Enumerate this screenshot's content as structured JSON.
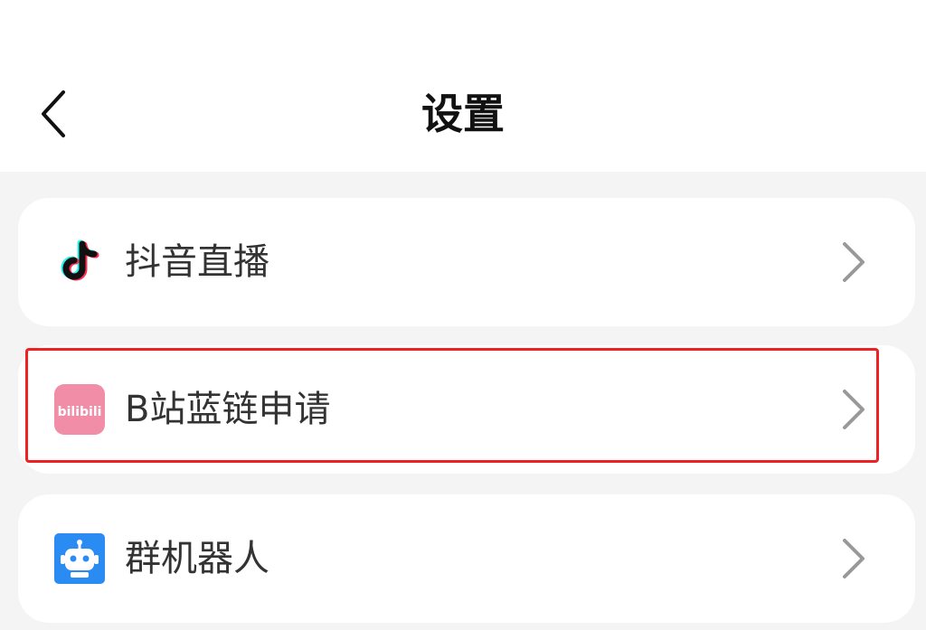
{
  "header": {
    "title": "设置",
    "back_icon": "chevron-left-icon"
  },
  "items": [
    {
      "label": "抖音直播",
      "icon": "douyin-icon",
      "chevron_icon": "chevron-right-icon"
    },
    {
      "label": "B站蓝链申请",
      "icon": "bilibili-icon",
      "icon_text": "bilibili",
      "chevron_icon": "chevron-right-icon",
      "highlighted": true
    },
    {
      "label": "群机器人",
      "icon": "robot-icon",
      "chevron_icon": "chevron-right-icon"
    }
  ],
  "colors": {
    "background": "#f4f4f4",
    "card": "#ffffff",
    "title": "#111111",
    "label": "#333333",
    "chevron": "#999999",
    "highlight": "#ee2222",
    "bilibili_pink": "#f28da7",
    "robot_blue": "#2a8cf2"
  }
}
